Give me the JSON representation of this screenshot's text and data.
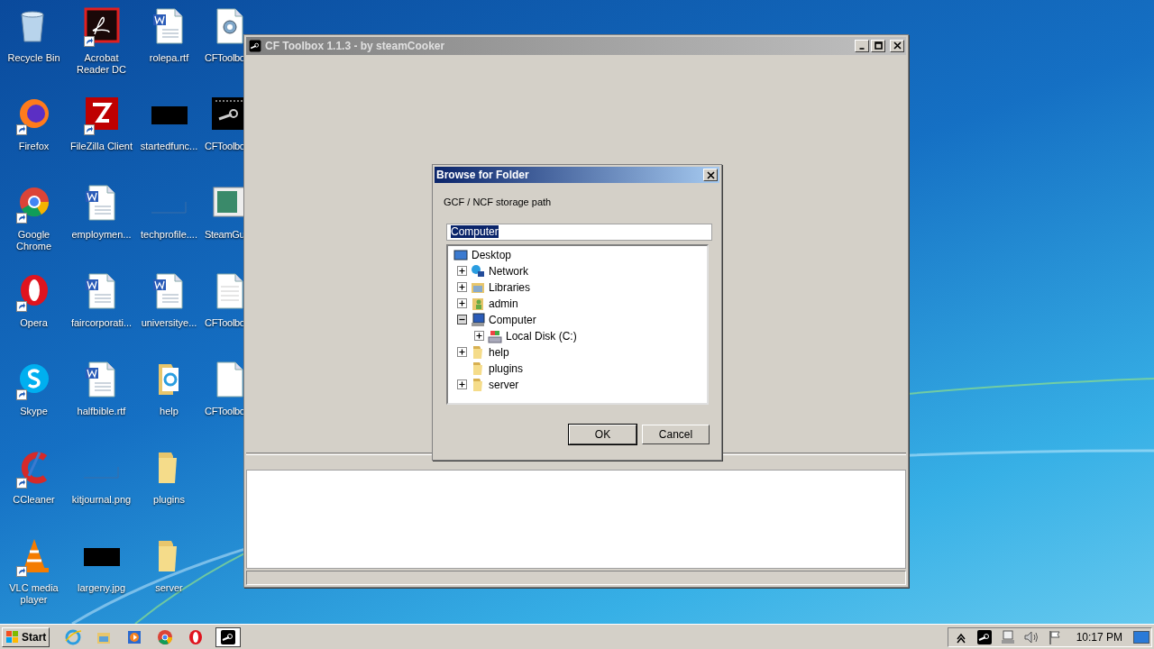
{
  "desktop_icons": [
    [
      {
        "label": "Recycle Bin",
        "kind": "recycle",
        "shortcut": false
      },
      {
        "label": "Acrobat Reader DC",
        "kind": "acrobat",
        "shortcut": true
      },
      {
        "label": "rolepa.rtf",
        "kind": "word",
        "shortcut": false
      },
      {
        "label": "CFToolbo",
        "kind": "config",
        "shortcut": false
      }
    ],
    [
      {
        "label": "Firefox",
        "kind": "firefox",
        "shortcut": true
      },
      {
        "label": "FileZilla Client",
        "kind": "filezilla",
        "shortcut": true
      },
      {
        "label": "startedfunc...",
        "kind": "dark-image",
        "shortcut": false
      },
      {
        "label": "CFToolbo",
        "kind": "steam-app",
        "shortcut": false
      }
    ],
    [
      {
        "label": "Google Chrome",
        "kind": "chrome",
        "shortcut": true
      },
      {
        "label": "employmen...",
        "kind": "word",
        "shortcut": false
      },
      {
        "label": "techprofile....",
        "kind": "blank-image",
        "shortcut": false
      },
      {
        "label": "SteamGu",
        "kind": "window-app",
        "shortcut": false
      }
    ],
    [
      {
        "label": "Opera",
        "kind": "opera",
        "shortcut": true
      },
      {
        "label": "faircorporati...",
        "kind": "word",
        "shortcut": false
      },
      {
        "label": "universitye...",
        "kind": "word",
        "shortcut": false
      },
      {
        "label": "CFToolbo",
        "kind": "text",
        "shortcut": false
      }
    ],
    [
      {
        "label": "Skype",
        "kind": "skype",
        "shortcut": true
      },
      {
        "label": "halfbible.rtf",
        "kind": "word",
        "shortcut": false
      },
      {
        "label": "help",
        "kind": "folder-ie",
        "shortcut": false
      },
      {
        "label": "CFToolbo",
        "kind": "blank-doc",
        "shortcut": false
      }
    ],
    [
      {
        "label": "CCleaner",
        "kind": "ccleaner",
        "shortcut": true
      },
      {
        "label": "kitjournal.png",
        "kind": "blank-image",
        "shortcut": false
      },
      {
        "label": "plugins",
        "kind": "folder",
        "shortcut": false
      }
    ],
    [
      {
        "label": "VLC media player",
        "kind": "vlc",
        "shortcut": true
      },
      {
        "label": "largeny.jpg",
        "kind": "dark-image",
        "shortcut": false
      },
      {
        "label": "server",
        "kind": "folder",
        "shortcut": false
      }
    ]
  ],
  "window": {
    "title": "CF Toolbox 1.1.3 - by steamCooker",
    "active": false
  },
  "dialog": {
    "title": "Browse for Folder",
    "active": true,
    "prompt": "GCF / NCF storage path",
    "path_field": {
      "value": "Computer"
    },
    "tree": [
      {
        "label": "Desktop",
        "kind": "desktop",
        "children": [
          {
            "label": "Network",
            "kind": "network",
            "expandable": true,
            "expanded": false
          },
          {
            "label": "Libraries",
            "kind": "libraries",
            "expandable": true,
            "expanded": false
          },
          {
            "label": "admin",
            "kind": "user",
            "expandable": true,
            "expanded": false
          },
          {
            "label": "Computer",
            "kind": "computer",
            "expandable": true,
            "expanded": true,
            "children": [
              {
                "label": "Local Disk (C:)",
                "kind": "disk",
                "expandable": true,
                "expanded": false
              }
            ]
          },
          {
            "label": "help",
            "kind": "folder",
            "expandable": true,
            "expanded": false
          },
          {
            "label": "plugins",
            "kind": "folder",
            "expandable": false
          },
          {
            "label": "server",
            "kind": "folder",
            "expandable": true,
            "expanded": false
          }
        ]
      }
    ],
    "buttons": [
      {
        "label": "OK",
        "default": true
      },
      {
        "label": "Cancel",
        "default": false
      }
    ]
  },
  "taskbar": {
    "start": "Start",
    "pinned": [
      {
        "kind": "ie"
      },
      {
        "kind": "explorer"
      },
      {
        "kind": "media"
      },
      {
        "kind": "chrome"
      },
      {
        "kind": "opera"
      }
    ],
    "tasks": [
      {
        "kind": "steam",
        "selected": true
      }
    ],
    "tray": [
      {
        "kind": "chevron"
      },
      {
        "kind": "steam"
      },
      {
        "kind": "network"
      },
      {
        "kind": "volume"
      },
      {
        "kind": "flag"
      }
    ],
    "clock": "10:17 PM"
  }
}
